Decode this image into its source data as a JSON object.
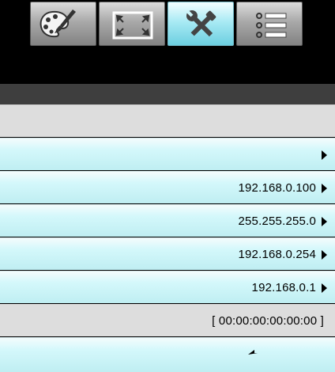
{
  "tabs": [
    {
      "icon": "palette-icon",
      "active": false
    },
    {
      "icon": "screen-resize-icon",
      "active": false
    },
    {
      "icon": "tools-icon",
      "active": true
    },
    {
      "icon": "list-menu-icon",
      "active": false
    }
  ],
  "rows": {
    "row1_value": "",
    "ip_address": "192.168.0.100",
    "subnet_mask": "255.255.255.0",
    "gateway": "192.168.0.254",
    "dns": "192.168.0.1",
    "mac_address": "[ 00:00:00:00:00:00 ]",
    "return_icon": "return-arrow-icon"
  },
  "colors": {
    "row_accent": "#bfeef2",
    "active_tab": "#a9eaf4",
    "section_bar": "#3e3e3e"
  }
}
